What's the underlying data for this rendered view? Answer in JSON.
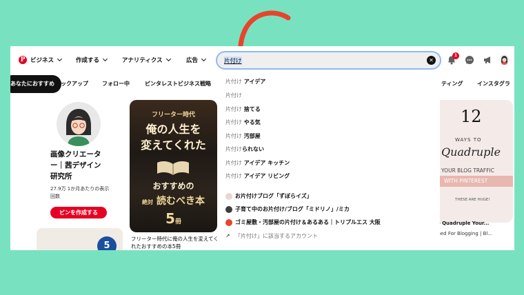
{
  "header": {
    "logo_letter": "P",
    "nav": [
      "ビジネス",
      "作成する",
      "アナリティクス",
      "広告"
    ],
    "search_value": "片付け",
    "notification_count": "1"
  },
  "tabs": {
    "active": "あなたにおすすめ",
    "items": [
      "ピックアップ",
      "フォロー中",
      "ピンタレストビジネス戦略",
      "ティング",
      "インスタグラ"
    ]
  },
  "profile": {
    "name": "画像クリエーター｜茜デザイン研究所",
    "stats": "27.9万 1か月あたりの表示回数",
    "create_pin_button": "ピンを作成する"
  },
  "book_pin": {
    "line1": "フリーター時代",
    "line2": "俺の人生を",
    "line3": "変えてくれた",
    "line4": "おすすめの",
    "line5": "絶対",
    "line6": "読むべき本",
    "number": "5",
    "unit": "冊",
    "caption": "フリーター時代に俺の人生を変えてくれたおすすめの本5冊"
  },
  "right_pin": {
    "number": "12",
    "ways": "WAYS TO",
    "script": "Quadruple",
    "line1": "YOUR BLOG TRAFFIC",
    "line2": "WITH PINTEREST",
    "line3": "THESE ARE HUGE!",
    "caption": "To Quadruple Your...",
    "caption2": "gned For Blogging | Bl..."
  },
  "left_bottom_badge": "5",
  "dropdown": {
    "prefix": "片付け",
    "suggestions": [
      {
        "pre": "片付け",
        "bold": " アイデア"
      },
      {
        "pre": "片付け",
        "bold": ""
      },
      {
        "pre": "片付け",
        "bold": " 捨てる"
      },
      {
        "pre": "片付け",
        "bold": " やる気"
      },
      {
        "pre": "片付け",
        "bold": " 汚部屋"
      },
      {
        "pre": "片付け",
        "bold": "られない"
      },
      {
        "pre": "片付け",
        "bold": " アイデア キッチン"
      },
      {
        "pre": "片付け",
        "bold": " アイデア リビング"
      }
    ],
    "accounts": [
      "お片付けブログ「ずぼらイズ」",
      "子育て中のお片付け/ブログ「ミドリノ」/ミカ",
      "ゴミ屋敷・汚部屋の片付け＆あるある｜トリプルエス 大阪"
    ],
    "account_search": "「片付け」に該当するアカウント"
  },
  "colors": {
    "background": "#78e2c0",
    "brand_red": "#e60023",
    "arrow": "#e8442c",
    "search_focus": "#8fb8f4"
  }
}
